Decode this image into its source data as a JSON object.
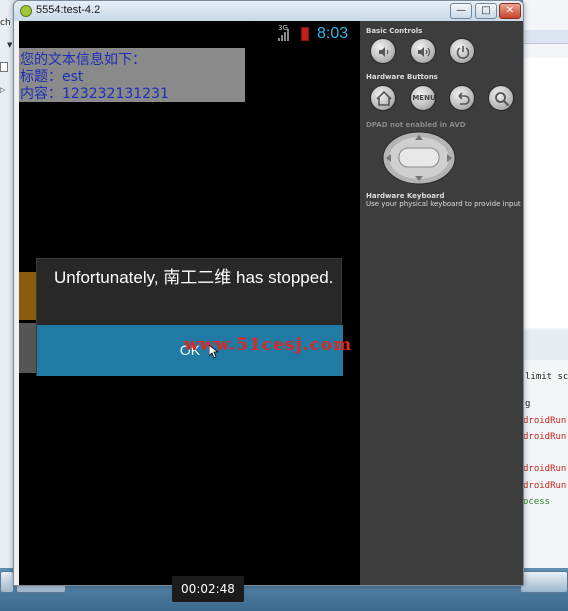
{
  "background": {
    "left_snippet": "ch",
    "right_snippets": [
      "limit scc",
      "g",
      "droidRun",
      "droidRun",
      "droidRun",
      "droidRun",
      "ocess"
    ]
  },
  "window": {
    "title": "5554:test-4.2",
    "buttons": {
      "minimize": "—",
      "maximize": "□",
      "close": "✕"
    }
  },
  "status_bar": {
    "network": "3G",
    "clock": "8:03"
  },
  "app": {
    "lines": [
      "您的文本信息如下：",
      "标题：est",
      "内容：123232131231"
    ]
  },
  "dialog": {
    "message": "Unfortunately, 南工二维 has stopped.",
    "ok_label": "OK"
  },
  "watermark": "www.51cesj.com",
  "controls": {
    "basic_controls_label": "Basic Controls",
    "hardware_buttons_label": "Hardware Buttons",
    "dpad_label": "DPAD not enabled in AVD",
    "keyboard_label": "Hardware Keyboard",
    "keyboard_sub": "Use your physical keyboard to provide input",
    "menu_label": "MENU",
    "icons": [
      "volume-down-icon",
      "volume-up-icon",
      "power-icon",
      "home-icon",
      "menu-icon",
      "back-icon",
      "search-icon"
    ]
  },
  "recording": {
    "timestamp": "00:02:48"
  }
}
